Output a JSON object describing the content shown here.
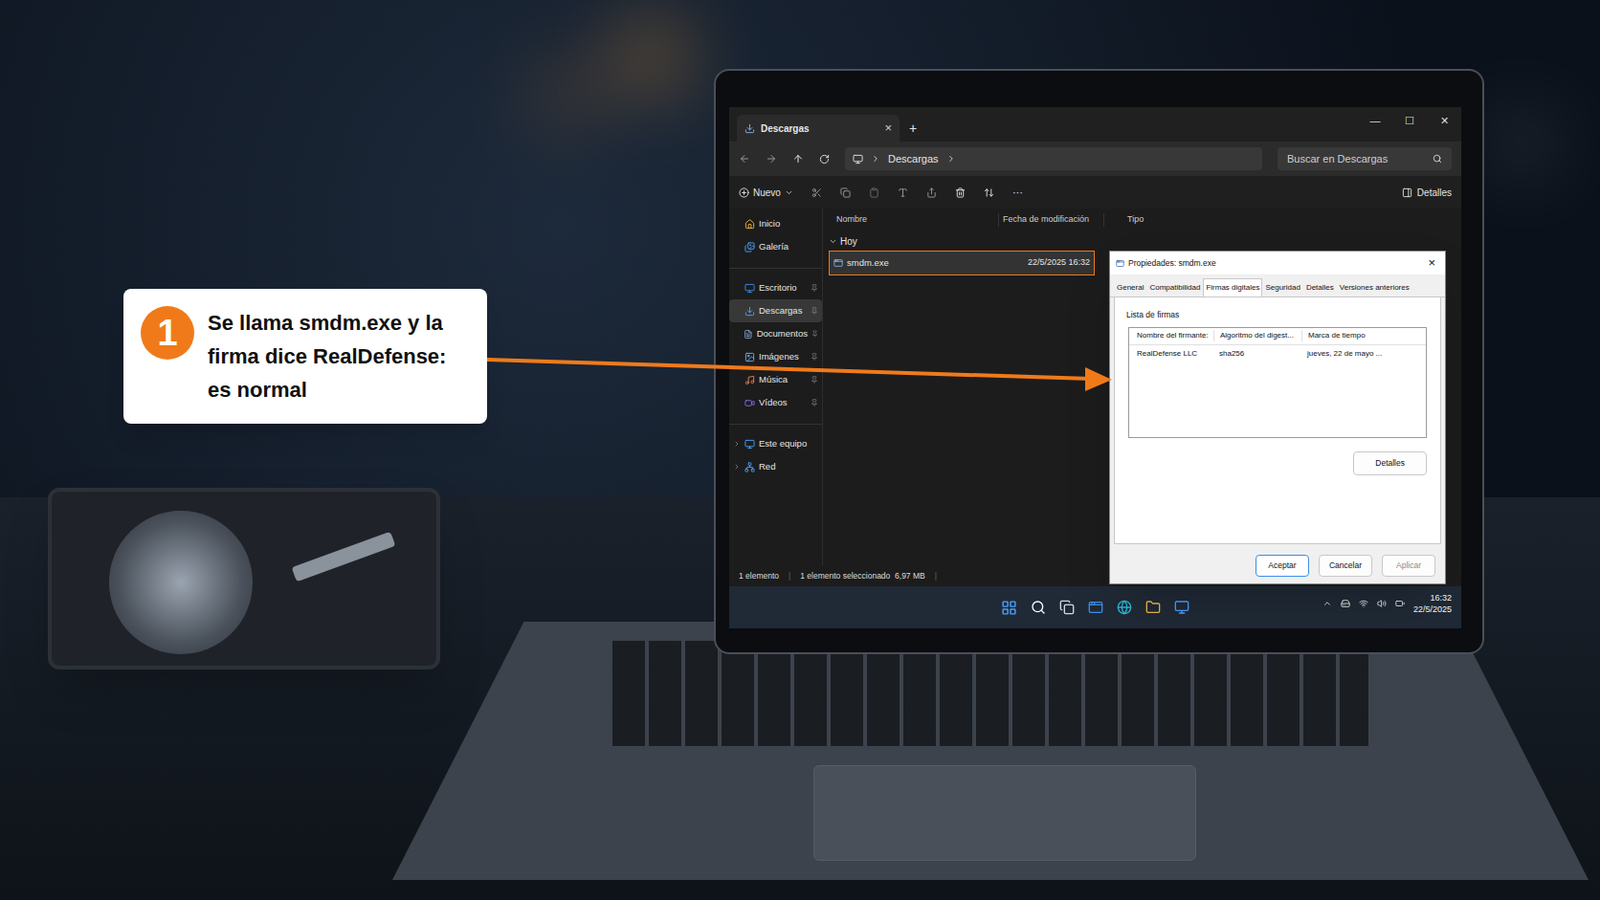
{
  "callout": {
    "number": "1",
    "text": "Se llama smdm.exe y la firma dice RealDefense: es normal"
  },
  "explorer": {
    "tab_title": "Descargas",
    "tab_close": "×",
    "new_tab": "+",
    "window_controls": [
      "—",
      "☐",
      "✕"
    ],
    "breadcrumb": [
      "Descargas"
    ],
    "search_placeholder": "Buscar en Descargas",
    "toolbar": {
      "new": "Nuevo",
      "more": "···",
      "details": "Detalles"
    },
    "sidebar": {
      "sections": [
        [
          {
            "label": "Inicio",
            "selected": false,
            "pinned": false,
            "expandable": false
          },
          {
            "label": "Galería",
            "selected": false,
            "pinned": false,
            "expandable": false
          }
        ],
        [
          {
            "label": "Escritorio",
            "selected": false,
            "pinned": true,
            "expandable": false
          },
          {
            "label": "Descargas",
            "selected": true,
            "pinned": true,
            "expandable": false
          },
          {
            "label": "Documentos",
            "selected": false,
            "pinned": true,
            "expandable": false
          },
          {
            "label": "Imágenes",
            "selected": false,
            "pinned": true,
            "expandable": false
          },
          {
            "label": "Música",
            "selected": false,
            "pinned": true,
            "expandable": false
          },
          {
            "label": "Vídeos",
            "selected": false,
            "pinned": true,
            "expandable": false
          }
        ],
        [
          {
            "label": "Este equipo",
            "selected": false,
            "pinned": false,
            "expandable": true
          },
          {
            "label": "Red",
            "selected": false,
            "pinned": false,
            "expandable": true
          }
        ]
      ]
    },
    "columns": [
      "Nombre",
      "Fecha de modificación",
      "Tipo"
    ],
    "group": {
      "label": "Hoy",
      "expanded": true
    },
    "files": [
      {
        "name": "smdm.exe",
        "modified": "22/5/2025 16:32",
        "selected": true
      }
    ],
    "status_bar": {
      "count": "1 elemento",
      "selection": "1 elemento seleccionado  6,97 MB"
    }
  },
  "dialog": {
    "title": "Propiedades: smdm.exe",
    "close": "×",
    "tabs": [
      {
        "label": "General",
        "selected": false
      },
      {
        "label": "Compatibilidad",
        "selected": false
      },
      {
        "label": "Firmas digitales",
        "selected": true
      },
      {
        "label": "Seguridad",
        "selected": false
      },
      {
        "label": "Detalles",
        "selected": false
      },
      {
        "label": "Versiones anteriores",
        "selected": false
      }
    ],
    "group_label": "Lista de firmas",
    "columns": [
      "Nombre del firmante:",
      "Algoritmo del digest...",
      "Marca de tiempo"
    ],
    "rows": [
      {
        "signer": "RealDefense LLC",
        "algorithm": "sha256",
        "timestamp": "jueves, 22 de mayo ...",
        "selected": false
      }
    ],
    "details_button": "Detalles",
    "buttons": [
      {
        "label": "Aceptar",
        "primary": true,
        "disabled": false
      },
      {
        "label": "Cancelar",
        "primary": false,
        "disabled": false
      },
      {
        "label": "Aplicar",
        "primary": false,
        "disabled": true
      }
    ]
  },
  "taskbar": {
    "time": "16:32",
    "date": "22/5/2025"
  }
}
